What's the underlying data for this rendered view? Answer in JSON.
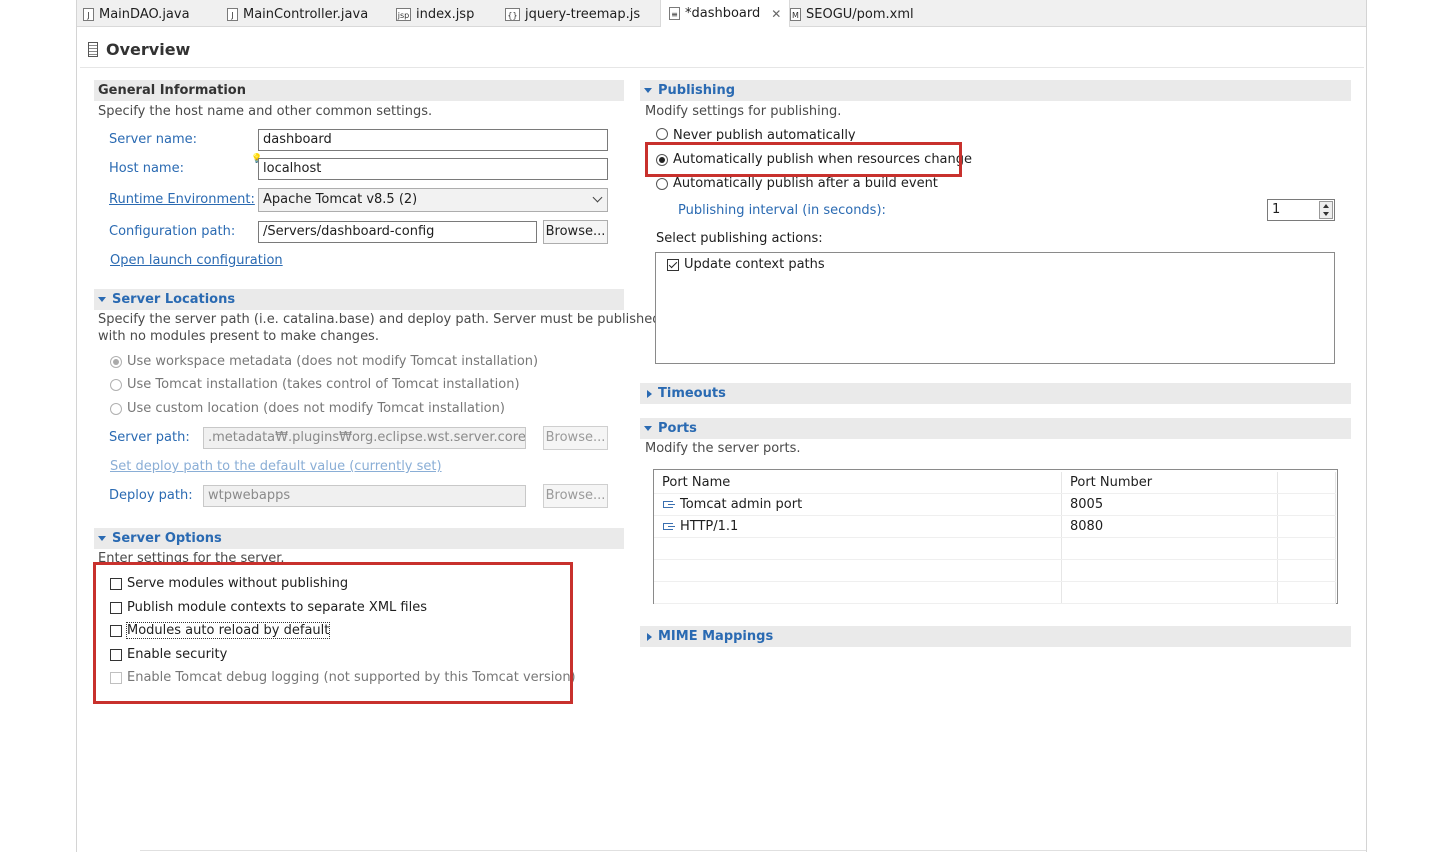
{
  "tabs": [
    {
      "label": "MainDAO.java",
      "icon": "java-file-icon"
    },
    {
      "label": "MainController.java",
      "icon": "java-file-icon"
    },
    {
      "label": "index.jsp",
      "icon": "jsp-file-icon"
    },
    {
      "label": "jquery-treemap.js",
      "icon": "js-file-icon"
    },
    {
      "label": "*dashboard",
      "icon": "server-doc-icon",
      "active": true
    },
    {
      "label": "SEOGU/pom.xml",
      "icon": "maven-file-icon"
    }
  ],
  "page_title": "Overview",
  "general": {
    "title": "General Information",
    "desc": "Specify the host name and other common settings.",
    "server_name_label": "Server name:",
    "server_name": "dashboard",
    "host_name_label": "Host name:",
    "host_name": "localhost",
    "runtime_label": "Runtime Environment:",
    "runtime": "Apache Tomcat v8.5 (2)",
    "config_label": "Configuration path:",
    "config_path": "/Servers/dashboard-config",
    "browse": "Browse...",
    "open_launch": "Open launch configuration"
  },
  "locations": {
    "title": "Server Locations",
    "desc1": "Specify the server path (i.e. catalina.base) and deploy path. Server must be published",
    "desc2": "with no modules present to make changes.",
    "opt1": "Use workspace metadata (does not modify Tomcat installation)",
    "opt2": "Use Tomcat installation (takes control of Tomcat installation)",
    "opt3": "Use custom location (does not modify Tomcat installation)",
    "server_path_label": "Server path:",
    "server_path": ".metadata₩.plugins₩org.eclipse.wst.server.core₩tmp",
    "browse": "Browse...",
    "set_deploy": "Set deploy path to the default value (currently set)",
    "deploy_label": "Deploy path:",
    "deploy_path": "wtpwebapps",
    "browse2": "Browse..."
  },
  "options": {
    "title": "Server Options",
    "desc": "Enter settings for the server.",
    "opt1": "Serve modules without publishing",
    "opt2": "Publish module contexts to separate XML files",
    "opt3": "Modules auto reload by default",
    "opt4": "Enable security",
    "opt5": "Enable Tomcat debug logging (not supported by this Tomcat version)"
  },
  "publishing": {
    "title": "Publishing",
    "desc": "Modify settings for publishing.",
    "opt1": "Never publish automatically",
    "opt2": "Automatically publish when resources change",
    "opt3": "Automatically publish after a build event",
    "interval_label": "Publishing interval (in seconds):",
    "interval": "1",
    "actions_label": "Select publishing actions:",
    "action1": "Update context paths"
  },
  "timeouts": {
    "title": "Timeouts"
  },
  "ports": {
    "title": "Ports",
    "desc": "Modify the server ports.",
    "col_name": "Port Name",
    "col_number": "Port Number",
    "rows": [
      {
        "name": "Tomcat admin port",
        "number": "8005"
      },
      {
        "name": "HTTP/1.1",
        "number": "8080"
      }
    ]
  },
  "mime": {
    "title": "MIME Mappings"
  },
  "colors": {
    "accent": "#2a6ab2",
    "highlight_box": "#c8312d",
    "section_bg": "#eaeaea"
  }
}
